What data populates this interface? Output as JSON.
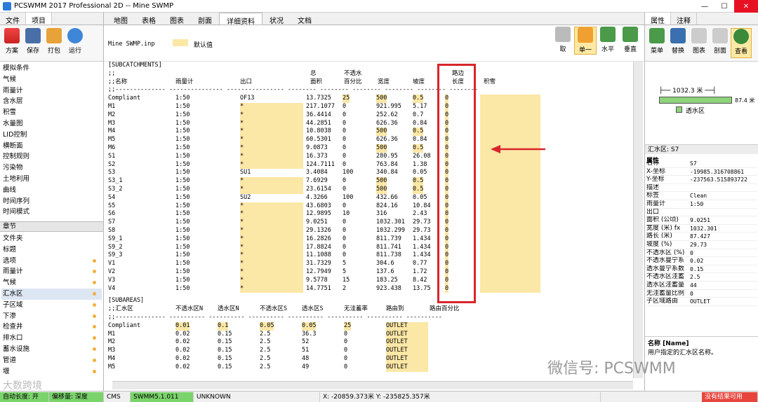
{
  "window": {
    "title": "PCSWMM 2017 Professional 2D -- Mine SWMP"
  },
  "left_tabs": [
    "文件",
    "项目"
  ],
  "left_buttons": [
    "方案",
    "保存",
    "打包",
    "运行"
  ],
  "left_list": [
    "模拟条件",
    "气候",
    "雨量计",
    "含水层",
    "积雪",
    "水量图",
    "LID控制",
    "横断面",
    "控制规则",
    "污染物",
    "土地利用",
    "曲线",
    "时间序列",
    "时间模式"
  ],
  "section_header": "章节",
  "section_list": [
    "文件夹",
    "标题",
    "选项",
    "雨量计",
    "气候",
    "汇水区",
    "子区域",
    "下渗",
    "检查井",
    "排水口",
    "蓄水设施",
    "管道",
    "堰"
  ],
  "main_tabs": [
    "地图",
    "表格",
    "图表",
    "剖面",
    "详细资料",
    "状况",
    "文档"
  ],
  "main_tools": [
    "取",
    "单一",
    "水平",
    "垂直"
  ],
  "file_label": "Mine SWMP.inp",
  "legend_label": "默认值",
  "subcatch": {
    "section": "[SUBCATCHMENTS]",
    "header_top": [
      ";;",
      "",
      "",
      "总",
      "不透水",
      "",
      "",
      "路边",
      ""
    ],
    "header": [
      ";;名称",
      "雨量计",
      "出口",
      "面积",
      "百分比",
      "宽度",
      "坡度",
      "长度",
      "积雪"
    ],
    "divider": ";;--------------  ---------------  ----------------  --------  --------  --------  --------  --------  --------",
    "rows": [
      [
        "Compliant",
        "1:50",
        "OF13",
        "13.7325",
        "25",
        "500",
        "0.5",
        "0"
      ],
      [
        "M1",
        "1:50",
        "*",
        "217.1077",
        "0",
        "921.995",
        "5.17",
        "0"
      ],
      [
        "M2",
        "1:50",
        "*",
        "36.4414",
        "0",
        "252.62",
        "0.7",
        "0"
      ],
      [
        "M3",
        "1:50",
        "*",
        "44.2851",
        "0",
        "626.36",
        "0.84",
        "0"
      ],
      [
        "M4",
        "1:50",
        "*",
        "10.8038",
        "0",
        "500",
        "0.5",
        "0"
      ],
      [
        "M5",
        "1:50",
        "*",
        "60.5301",
        "0",
        "626.36",
        "0.84",
        "0"
      ],
      [
        "M6",
        "1:50",
        "*",
        "9.0873",
        "0",
        "500",
        "0.5",
        "0"
      ],
      [
        "S1",
        "1:50",
        "*",
        "16.373",
        "0",
        "280.95",
        "26.08",
        "0"
      ],
      [
        "S2",
        "1:50",
        "*",
        "124.7111",
        "0",
        "763.84",
        "1.38",
        "0"
      ],
      [
        "S3",
        "1:50",
        "SU1",
        "3.4084",
        "100",
        "340.84",
        "0.05",
        "0"
      ],
      [
        "S3_1",
        "1:50",
        "*",
        "7.6929",
        "0",
        "500",
        "0.5",
        "0"
      ],
      [
        "S3_2",
        "1:50",
        "*",
        "23.6154",
        "0",
        "500",
        "0.5",
        "0"
      ],
      [
        "S4",
        "1:50",
        "SU2",
        "4.3266",
        "100",
        "432.66",
        "0.05",
        "0"
      ],
      [
        "S5",
        "1:50",
        "*",
        "43.6803",
        "0",
        "824.16",
        "10.84",
        "0"
      ],
      [
        "S6",
        "1:50",
        "*",
        "12.9895",
        "10",
        "316",
        "2.43",
        "0"
      ],
      [
        "S7",
        "1:50",
        "*",
        "9.0251",
        "0",
        "1032.301",
        "29.73",
        "0"
      ],
      [
        "S8",
        "1:50",
        "*",
        "29.1326",
        "0",
        "1032.299",
        "29.73",
        "0"
      ],
      [
        "S9_1",
        "1:50",
        "*",
        "16.2826",
        "0",
        "811.739",
        "1.434",
        "0"
      ],
      [
        "S9_2",
        "1:50",
        "*",
        "17.8824",
        "0",
        "811.741",
        "1.434",
        "0"
      ],
      [
        "S9_3",
        "1:50",
        "*",
        "11.1088",
        "0",
        "811.738",
        "1.434",
        "0"
      ],
      [
        "V1",
        "1:50",
        "*",
        "31.7329",
        "5",
        "304.6",
        "0.77",
        "0"
      ],
      [
        "V2",
        "1:50",
        "*",
        "12.7949",
        "5",
        "137.6",
        "1.72",
        "0"
      ],
      [
        "V3",
        "1:50",
        "*",
        "9.5778",
        "15",
        "183.25",
        "8.42",
        "0"
      ],
      [
        "V4",
        "1:50",
        "*",
        "14.7751",
        "2",
        "923.438",
        "13.75",
        "0"
      ]
    ]
  },
  "subareas": {
    "section": "[SUBAREAS]",
    "header": [
      ";;汇水区",
      "不透水区N",
      "透水区N",
      "不透水区S",
      "透水区S",
      "无洼蓄率",
      "路由到",
      "路由百分比"
    ],
    "divider": ";;--------------  ----------  ----------  ----------  ----------  ----------  ----------  ----------",
    "rows": [
      [
        "Compliant",
        "0.01",
        "0.1",
        "0.05",
        "0.05",
        "25",
        "OUTLET"
      ],
      [
        "M1",
        "0.02",
        "0.15",
        "2.5",
        "36.3",
        "0",
        "OUTLET"
      ],
      [
        "M2",
        "0.02",
        "0.15",
        "2.5",
        "52",
        "0",
        "OUTLET"
      ],
      [
        "M3",
        "0.02",
        "0.15",
        "2.5",
        "51",
        "0",
        "OUTLET"
      ],
      [
        "M4",
        "0.02",
        "0.15",
        "2.5",
        "48",
        "0",
        "OUTLET"
      ],
      [
        "M5",
        "0.02",
        "0.15",
        "2.5",
        "49",
        "0",
        "OUTLET"
      ]
    ]
  },
  "right_tabs": [
    "属性",
    "注释"
  ],
  "right_buttons": [
    "菜单",
    "替换",
    "图表",
    "剖面",
    "查看"
  ],
  "right_diagram": {
    "width_label": "1032.3 米",
    "len_label": "87.4 米",
    "legend": "透水区"
  },
  "selection_title": "汇水区: S7",
  "props_header": "属性",
  "props": [
    [
      "名称",
      "S7"
    ],
    [
      "X-坐标",
      "-19985.316708861"
    ],
    [
      "Y-坐标",
      "-237563.515893722"
    ],
    [
      "描述",
      ""
    ],
    [
      "标签",
      "Clean"
    ],
    [
      "雨量计",
      "1:50"
    ],
    [
      "出口",
      ""
    ],
    [
      "面积 (公顷)",
      "9.0251"
    ],
    [
      "宽度 (米) fx",
      "1032.301"
    ],
    [
      "路长 (米)",
      "87.427"
    ],
    [
      "坡度 (%)",
      "29.73"
    ],
    [
      "不透水区 (%)",
      "0"
    ],
    [
      "不透水曼宁系",
      "0.02"
    ],
    [
      "透水曼宁系数",
      "0.15"
    ],
    [
      "不透水区洼蓄",
      "2.5"
    ],
    [
      "透水区洼蓄量",
      "44"
    ],
    [
      "无洼蓄量比例",
      "0"
    ],
    [
      "子区域路由",
      "OUTLET"
    ]
  ],
  "help": {
    "title": "名称 [Name]",
    "text": "用户指定的汇水区名称。"
  },
  "status": {
    "label1": "自动长度: 开",
    "label2": "偏移量: 深度",
    "units": "CMS",
    "engine": "SWMM5.1.011",
    "state": "UNKNOWN",
    "coords": "X: -20859.373米  Y: -235825.357米",
    "results": "没有结果可用"
  },
  "watermark": "微信号: PCSWMM",
  "watermark2": "大数跨境",
  "colors": {
    "highlight": "#fbe7a6",
    "redbox": "#d9252b",
    "status_green": "#7ad36b"
  }
}
